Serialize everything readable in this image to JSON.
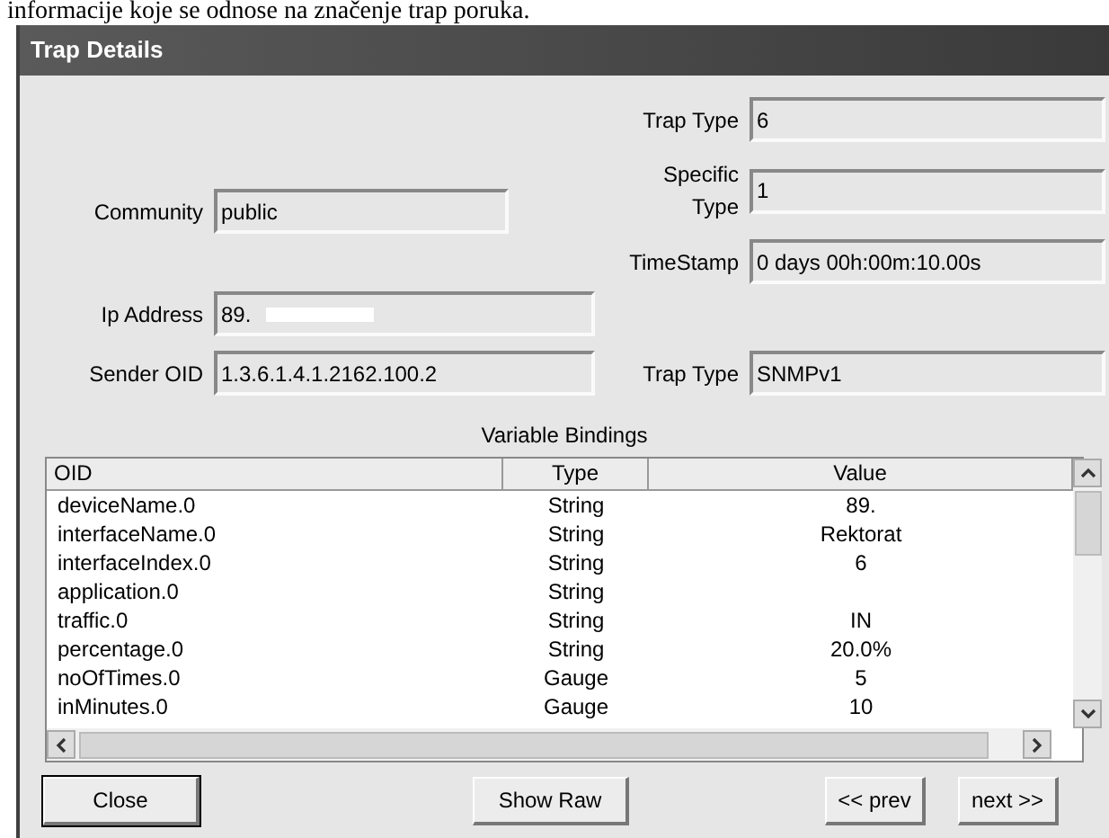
{
  "document_text": "informacije koje se odnose na značenje trap poruka.",
  "window": {
    "title": "Trap Details"
  },
  "fields_right": [
    {
      "label": "Trap Type",
      "value": "6"
    },
    {
      "label": "Specific Type",
      "value": "1"
    },
    {
      "label": "TimeStamp",
      "value": "0 days 00h:00m:10.00s"
    }
  ],
  "fields_left": [
    {
      "label": "Community",
      "value": "public",
      "redacted": false
    },
    {
      "label": "Ip Address",
      "value": "89.",
      "redacted": true
    }
  ],
  "sender_row": [
    {
      "label": "Sender OID",
      "value": "1.3.6.1.4.1.2162.100.2"
    },
    {
      "label": "Trap Type",
      "value": "SNMPv1"
    }
  ],
  "bindings": {
    "title": "Variable Bindings",
    "columns": [
      "OID",
      "Type",
      "Value"
    ],
    "rows": [
      [
        "deviceName.0",
        "String",
        "89."
      ],
      [
        "interfaceName.0",
        "String",
        "Rektorat"
      ],
      [
        "interfaceIndex.0",
        "String",
        "6"
      ],
      [
        "application.0",
        "String",
        ""
      ],
      [
        "traffic.0",
        "String",
        "IN"
      ],
      [
        "percentage.0",
        "String",
        "20.0%"
      ],
      [
        "noOfTimes.0",
        "Gauge",
        "5"
      ],
      [
        "inMinutes.0",
        "Gauge",
        "10"
      ]
    ]
  },
  "buttons": [
    {
      "label": "Close",
      "default": true
    },
    {
      "label": "Show Raw",
      "default": false
    },
    {
      "label": "<< prev",
      "default": false
    },
    {
      "label": "next >>",
      "default": false
    }
  ]
}
